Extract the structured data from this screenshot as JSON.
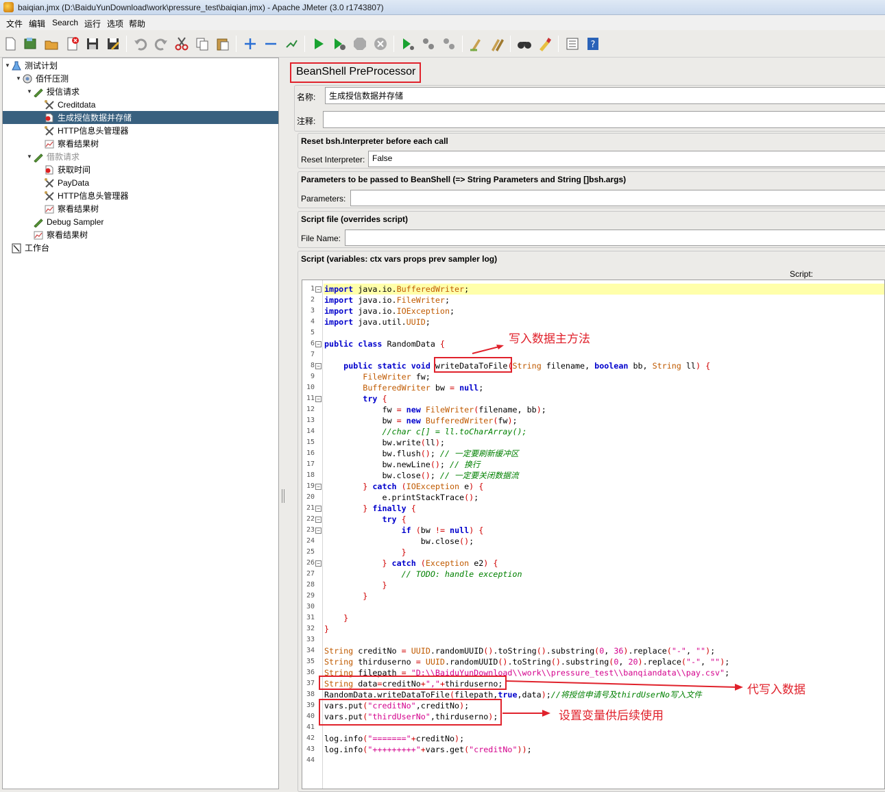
{
  "window": {
    "title": "baiqian.jmx (D:\\BaiduYunDownload\\work\\pressure_test\\baiqian.jmx) - Apache JMeter (3.0 r1743807)"
  },
  "menu": [
    "文件",
    "编辑",
    "Search",
    "运行",
    "选项",
    "帮助"
  ],
  "toolbar": [
    "new-icon",
    "templates-icon",
    "open-icon",
    "close-icon",
    "save-icon",
    "save-as-icon",
    "undo-icon",
    "redo-icon",
    "cut-icon",
    "copy-icon",
    "paste-icon",
    "expand-icon",
    "collapse-icon",
    "toggle-icon",
    "start-icon",
    "start-no-pause-icon",
    "stop-icon",
    "shutdown-icon",
    "remote-start-icon",
    "remote-stop-icon",
    "remote-shutdown-icon",
    "clear-icon",
    "clear-all-icon",
    "search-icon",
    "reset-search-icon",
    "function-helper-icon",
    "help-icon"
  ],
  "tree": {
    "nodes": [
      {
        "label": "测试计划",
        "indent": 0,
        "toggle": "▼",
        "icon": "test-plan-icon"
      },
      {
        "label": "佰仟压测",
        "indent": 1,
        "toggle": "▼",
        "icon": "thread-group-icon"
      },
      {
        "label": "授信请求",
        "indent": 2,
        "toggle": "▼",
        "icon": "sampler-icon"
      },
      {
        "label": "Creditdata",
        "indent": 3,
        "toggle": "",
        "icon": "config-icon"
      },
      {
        "label": "生成授信数据并存储",
        "indent": 3,
        "toggle": "",
        "icon": "preprocessor-icon",
        "selected": true
      },
      {
        "label": "HTTP信息头管理器",
        "indent": 3,
        "toggle": "",
        "icon": "config-icon"
      },
      {
        "label": "察看结果树",
        "indent": 3,
        "toggle": "",
        "icon": "listener-icon"
      },
      {
        "label": "借款请求",
        "indent": 2,
        "toggle": "▼",
        "icon": "sampler-icon",
        "disabled": true
      },
      {
        "label": "获取时间",
        "indent": 3,
        "toggle": "",
        "icon": "preprocessor-icon"
      },
      {
        "label": "PayData",
        "indent": 3,
        "toggle": "",
        "icon": "config-icon"
      },
      {
        "label": "HTTP信息头管理器",
        "indent": 3,
        "toggle": "",
        "icon": "config-icon"
      },
      {
        "label": "察看结果树",
        "indent": 3,
        "toggle": "",
        "icon": "listener-icon"
      },
      {
        "label": "Debug Sampler",
        "indent": 2,
        "toggle": "",
        "icon": "sampler-icon"
      },
      {
        "label": "察看结果树",
        "indent": 2,
        "toggle": "",
        "icon": "listener-icon"
      },
      {
        "label": "工作台",
        "indent": 0,
        "toggle": "",
        "icon": "workbench-icon"
      }
    ]
  },
  "panel": {
    "title": "BeanShell PreProcessor",
    "name_label": "名称:",
    "name_value": "生成授信数据并存储",
    "comment_label": "注释:",
    "comment_value": "",
    "reset_section_title": "Reset bsh.Interpreter before each call",
    "reset_label": "Reset Interpreter:",
    "reset_value": "False",
    "params_section_title": "Parameters to be passed to BeanShell (=> String Parameters and String []bsh.args)",
    "params_label": "Parameters:",
    "params_value": "",
    "file_section_title": "Script file (overrides script)",
    "file_label": "File Name:",
    "file_value": "",
    "script_section_title": "Script (variables: ctx vars props prev sampler log)",
    "script_header": "Script:"
  },
  "script_lines": [
    "import java.io.BufferedWriter;",
    "import java.io.FileWriter;",
    "import java.io.IOException;",
    "import java.util.UUID;",
    "",
    "public class RandomData {",
    "",
    "    public static void writeDataToFile(String filename, boolean bb, String ll) {",
    "        FileWriter fw;",
    "        BufferedWriter bw = null;",
    "        try {",
    "            fw = new FileWriter(filename, bb);",
    "            bw = new BufferedWriter(fw);",
    "            //char c[] = ll.toCharArray();",
    "            bw.write(ll);",
    "            bw.flush(); // 一定要刷新缓冲区",
    "            bw.newLine(); // 换行",
    "            bw.close(); // 一定要关闭数据流",
    "        } catch (IOException e) {",
    "            e.printStackTrace();",
    "        } finally {",
    "            try {",
    "                if (bw != null) {",
    "                    bw.close();",
    "                }",
    "            } catch (Exception e2) {",
    "                // TODO: handle exception",
    "            }",
    "        }",
    "",
    "    }",
    "}",
    "",
    "String creditNo = UUID.randomUUID().toString().substring(0, 36).replace(\"-\", \"\");",
    "String thirduserno = UUID.randomUUID().toString().substring(0, 20).replace(\"-\", \"\");",
    "String filepath = \"D:\\\\BaiduYunDownload\\\\work\\\\pressure_test\\\\banqiandata\\\\pay.csv\";",
    "String data=creditNo+\",\"+thirduserno;",
    "RandomData.writeDataToFile(filepath,true,data);//将授信申请号及thirdUserNo写入文件",
    "vars.put(\"creditNo\",creditNo);",
    "vars.put(\"thirdUserNo\",thirduserno);",
    "",
    "log.info(\"=======\"+creditNo);",
    "log.info(\"+++++++++\"+vars.get(\"creditNo\"));",
    ""
  ],
  "fold_lines": [
    1,
    6,
    8,
    11,
    19,
    21,
    22,
    23,
    26
  ],
  "annotations": {
    "main_method": "写入数据主方法",
    "write_data": "代写入数据",
    "set_vars": "设置变量供后续使用"
  },
  "colors": {
    "selection": "#38607f",
    "annotation_red": "#e0212b",
    "line_highlight": "#ffffaa"
  }
}
